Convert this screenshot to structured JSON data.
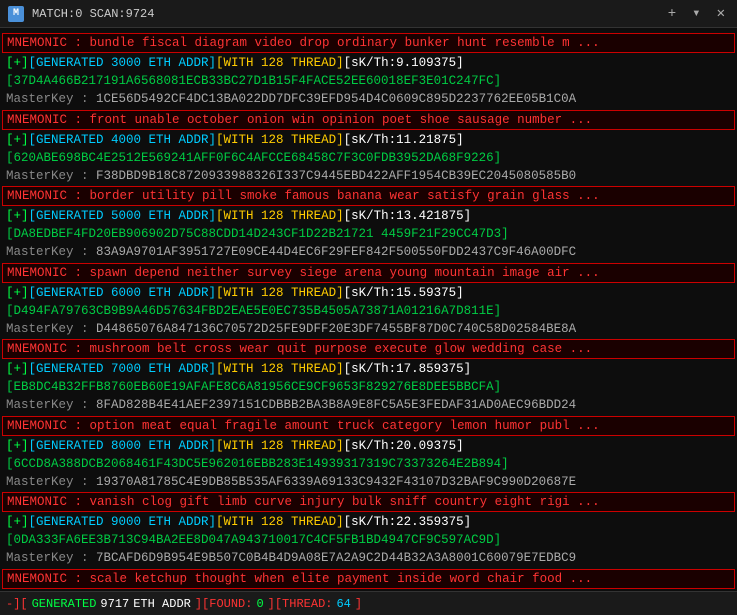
{
  "titleBar": {
    "icon": "M",
    "title": "MATCH:0 SCAN:9724",
    "plusBtn": "+",
    "chevronBtn": "▾",
    "closeBtn": "✕"
  },
  "lines": [
    {
      "type": "mnemonic",
      "text": "MNEMONIC : bundle fiscal diagram video drop ordinary bunker hunt resemble m ..."
    },
    {
      "type": "generated",
      "prefix": "[+][GENERATED 3000 ETH ADDR][WITH 128 THREAD]",
      "suffix": "[sK/Th:9.109375]"
    },
    {
      "type": "addr",
      "text": "[37D4A466B217191A6568081ECB33BC27D1B15F4FACE52EE60018EF3E01C247FC]"
    },
    {
      "type": "masterkey",
      "prefix": "MasterKey : ",
      "text": "1CE56D5492CF4DC13BA022DD7DFC39EFD954D4C0609C895D2237762EE05B1C0A"
    },
    {
      "type": "mnemonic",
      "text": "MNEMONIC : front unable october onion win opinion poet shoe sausage number ..."
    },
    {
      "type": "generated",
      "prefix": "[+][GENERATED 4000 ETH ADDR][WITH 128 THREAD]",
      "suffix": "[sK/Th:11.21875]"
    },
    {
      "type": "addr",
      "text": "[620ABE698BC4E2512E569241AFF0F6C4AFCCE68458C7F3C0FDB3952DA68F9226]"
    },
    {
      "type": "masterkey",
      "prefix": "MasterKey : ",
      "text": "F38DBD9B18C8720933988326I337C9445EBD422AFF1954CB39EC2045080585B0"
    },
    {
      "type": "mnemonic",
      "text": "MNEMONIC : border utility pill smoke famous banana wear satisfy grain glass ..."
    },
    {
      "type": "generated",
      "prefix": "[+][GENERATED 5000 ETH ADDR][WITH 128 THREAD]",
      "suffix": "[sK/Th:13.421875]"
    },
    {
      "type": "addr",
      "text": "[DA8EDBEF4FD20EB906902D75C88CDD14D243CF1D22B21721 4459F21F29CC47D3]"
    },
    {
      "type": "masterkey",
      "prefix": "MasterKey : ",
      "text": "83A9A9701AF3951727E09CE44D4EC6F29FEF842F500550FDD2437C9F46A00DFC"
    },
    {
      "type": "mnemonic",
      "text": "MNEMONIC : spawn depend neither survey siege arena young mountain image air ..."
    },
    {
      "type": "generated",
      "prefix": "[+][GENERATED 6000 ETH ADDR][WITH 128 THREAD]",
      "suffix": "[sK/Th:15.59375]"
    },
    {
      "type": "addr",
      "text": "[D494FA79763CB9B9A46D57634FBD2EAE5E0EC735B4505A73871A01216A7D811E]"
    },
    {
      "type": "masterkey",
      "prefix": "MasterKey : ",
      "text": "D44865076A847136C70572D25FE9DFF20E3DF7455BF87D0C740C58D02584BE8A"
    },
    {
      "type": "mnemonic",
      "text": "MNEMONIC : mushroom belt cross wear quit purpose execute glow wedding case ..."
    },
    {
      "type": "generated",
      "prefix": "[+][GENERATED 7000 ETH ADDR][WITH 128 THREAD]",
      "suffix": "[sK/Th:17.859375]"
    },
    {
      "type": "addr",
      "text": "[EB8DC4B32FFB8760EB60E19AFAFE8C6A81956CE9CF9653F829276E8DEE5BBCFA]"
    },
    {
      "type": "masterkey",
      "prefix": "MasterKey : ",
      "text": "8FAD828B4E41AEF2397151CDBBB2BA3B8A9E8FC5A5E3FEDAF31AD0AEC96BDD24"
    },
    {
      "type": "mnemonic",
      "text": "MNEMONIC : option meat equal fragile amount truck category lemon humor publ ..."
    },
    {
      "type": "generated",
      "prefix": "[+][GENERATED 8000 ETH ADDR][WITH 128 THREAD]",
      "suffix": "[sK/Th:20.09375]"
    },
    {
      "type": "addr",
      "text": "[6CCD8A388DCB2068461F43DC5E962016EBB283E14939317319C73373264E2B894]"
    },
    {
      "type": "masterkey",
      "prefix": "MasterKey : ",
      "text": "19370A81785C4E9DB85B535AF6339A69133C9432F43107D32BAF9C990D20687E"
    },
    {
      "type": "mnemonic",
      "text": "MNEMONIC : vanish clog gift limb curve injury bulk sniff country eight rigi ..."
    },
    {
      "type": "generated",
      "prefix": "[+][GENERATED 9000 ETH ADDR][WITH 128 THREAD]",
      "suffix": "[sK/Th:22.359375]"
    },
    {
      "type": "addr",
      "text": "[0DA333FA6EE3B713C94BA2EE8D047A943710017C4CF5FB1BD4947CF9C597AC9D]"
    },
    {
      "type": "masterkey",
      "prefix": "MasterKey : ",
      "text": "7BCAFD6D9B954E9B507C0B4B4D9A08E7A2A9C2D44B32A3A8001C60079E7EDBC9"
    },
    {
      "type": "mnemonic",
      "text": "MNEMONIC : scale ketchup thought when elite payment inside word chair food ..."
    }
  ],
  "statusBar": {
    "prefix": "-][",
    "generated": "GENERATED",
    "scan": "9717",
    "addrLabel": "ETH ADDR",
    "foundLabel": "][FOUND:",
    "foundVal": "0",
    "threadLabel": "][THREAD:",
    "threadVal": "64",
    "suffix": "]"
  }
}
